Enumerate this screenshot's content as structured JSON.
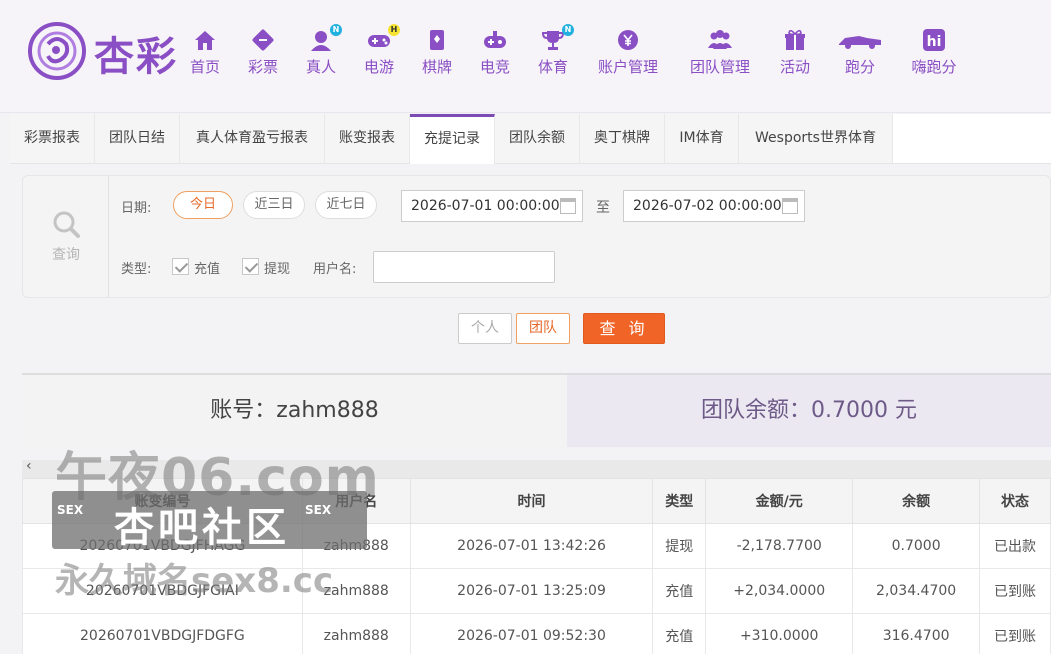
{
  "brand": {
    "logo_text": "杏彩"
  },
  "nav": [
    {
      "label": "首页",
      "icon": "home-icon"
    },
    {
      "label": "彩票",
      "icon": "lottery-ticket-icon"
    },
    {
      "label": "真人",
      "icon": "live-dealer-icon",
      "badge": "N"
    },
    {
      "label": "电游",
      "icon": "gamepad-icon",
      "badge": "H"
    },
    {
      "label": "棋牌",
      "icon": "cards-icon"
    },
    {
      "label": "电竞",
      "icon": "esports-controller-icon"
    },
    {
      "label": "体育",
      "icon": "trophy-icon",
      "badge": "N"
    },
    {
      "label": "账户管理",
      "icon": "yen-coin-icon"
    },
    {
      "label": "团队管理",
      "icon": "team-icon"
    },
    {
      "label": "活动",
      "icon": "gift-icon"
    },
    {
      "label": "跑分",
      "icon": "race-car-icon"
    },
    {
      "label": "嗨跑分",
      "icon": "hi-app-icon"
    }
  ],
  "tabs": [
    "彩票报表",
    "团队日结",
    "真人体育盈亏报表",
    "账变报表",
    "充提记录",
    "团队余额",
    "奥丁棋牌",
    "IM体育",
    "Wesports世界体育"
  ],
  "active_tab": "充提记录",
  "filter": {
    "side_label": "查询",
    "date_label": "日期:",
    "quick_ranges": [
      "今日",
      "近三日",
      "近七日"
    ],
    "date_from": "2026-07-01 00:00:00",
    "to_label": "至",
    "date_to": "2026-07-02 00:00:00",
    "type_label": "类型:",
    "type_options": [
      "充值",
      "提现"
    ],
    "username_label": "用户名:",
    "username_value": ""
  },
  "buttons": {
    "personal": "个人",
    "team": "团队",
    "query": "查 询"
  },
  "summary": {
    "account": "账号：zahm888",
    "team_balance": "团队余额：0.7000 元"
  },
  "scroll_arrow": "‹",
  "table": {
    "headers": [
      "账变编号",
      "用户名",
      "时间",
      "类型",
      "金额/元",
      "余额",
      "状态"
    ],
    "rows": [
      [
        "20260701VBDGJFHAGG",
        "zahm888",
        "2026-07-01 13:42:26",
        "提现",
        "-2,178.7700",
        "0.7000",
        "已出款"
      ],
      [
        "20260701VBDGJFGIAI",
        "zahm888",
        "2026-07-01 13:25:09",
        "充值",
        "+2,034.0000",
        "2,034.4700",
        "已到账"
      ],
      [
        "20260701VBDGJFDGFG",
        "zahm888",
        "2026-07-01 09:52:30",
        "充值",
        "+310.0000",
        "316.4700",
        "已到账"
      ]
    ]
  },
  "watermark": {
    "line1": "午夜06.com",
    "line2": "杏吧社区",
    "tag": "SEX",
    "line3": "永久域名sex8.cc"
  },
  "colors": {
    "brand_purple": "#8a4fc4",
    "accent_orange": "#f06428",
    "negative": "#e25a1c",
    "positive": "#44a532"
  }
}
